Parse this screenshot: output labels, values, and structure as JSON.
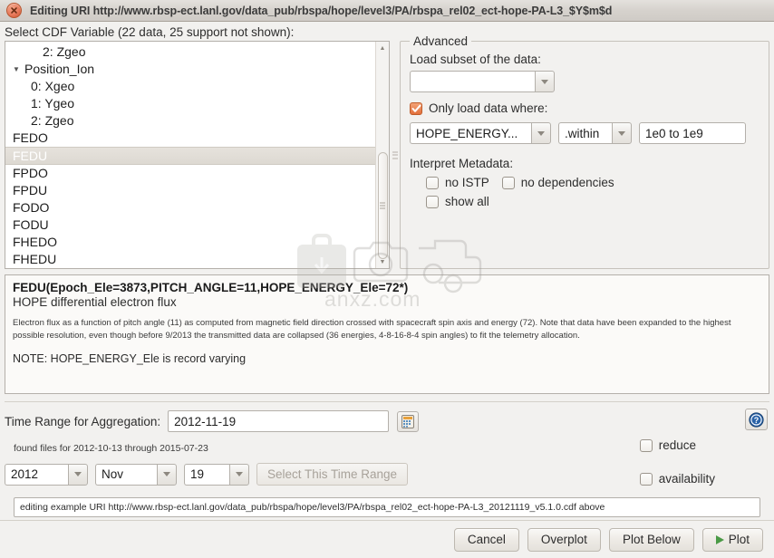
{
  "window": {
    "title": "Editing URI http://www.rbsp-ect.lanl.gov/data_pub/rbspa/hope/level3/PA/rbspa_rel02_ect-hope-PA-L3_$Y$m$d",
    "close_icon": "close-icon"
  },
  "variable_panel": {
    "label": "Select CDF Variable (22 data, 25 support not shown):",
    "rows": [
      {
        "text": "2: Zgeo",
        "indent": 1,
        "twisty": "",
        "selected": false
      },
      {
        "text": "Position_Ion",
        "indent": 0,
        "twisty": "▼",
        "selected": false
      },
      {
        "text": "0: Xgeo",
        "indent": 1,
        "twisty": "",
        "selected": false
      },
      {
        "text": "1: Ygeo",
        "indent": 1,
        "twisty": "",
        "selected": false
      },
      {
        "text": "2: Zgeo",
        "indent": 1,
        "twisty": "",
        "selected": false
      },
      {
        "text": "FEDO",
        "indent": 0,
        "twisty": "",
        "selected": false
      },
      {
        "text": "FEDU",
        "indent": 0,
        "twisty": "",
        "selected": true
      },
      {
        "text": "FPDO",
        "indent": 0,
        "twisty": "",
        "selected": false
      },
      {
        "text": "FPDU",
        "indent": 0,
        "twisty": "",
        "selected": false
      },
      {
        "text": "FODO",
        "indent": 0,
        "twisty": "",
        "selected": false
      },
      {
        "text": "FODU",
        "indent": 0,
        "twisty": "",
        "selected": false
      },
      {
        "text": "FHEDO",
        "indent": 0,
        "twisty": "",
        "selected": false
      },
      {
        "text": "FHEDU",
        "indent": 0,
        "twisty": "",
        "selected": false
      }
    ]
  },
  "advanced": {
    "legend": "Advanced",
    "load_subset_label": "Load subset of the data:",
    "load_subset_value": "",
    "only_load_checkbox": {
      "label": "Only load data where:",
      "checked": true
    },
    "filter": {
      "variable": "HOPE_ENERGY...",
      "operator": ".within",
      "value": "1e0 to 1e9"
    },
    "interpret_metadata_label": "Interpret Metadata:",
    "no_istp": {
      "label": "no ISTP",
      "checked": false
    },
    "no_dependencies": {
      "label": "no dependencies",
      "checked": false
    },
    "show_all": {
      "label": "show all",
      "checked": false
    }
  },
  "description": {
    "signature": "FEDU(Epoch_Ele=3873,PITCH_ANGLE=11,HOPE_ENERGY_Ele=72*)",
    "summary": "HOPE differential electron flux",
    "body": "Electron flux as a function of pitch angle (11) as computed from magnetic field direction crossed with spacecraft spin axis and energy (72). Note that data have been expanded to the highest possible resolution, even though before 9/2013 the transmitted data are collapsed (36 energies, 4-8-16-8-4 spin angles) to fit the telemetry allocation.",
    "note": "NOTE: HOPE_ENERGY_Ele is record varying"
  },
  "time_range": {
    "label": "Time Range for Aggregation:",
    "value": "2012-11-19",
    "calendar_icon": "calendar-icon",
    "help_icon": "help-icon",
    "found_files": "found files for 2012-10-13 through 2015-07-23",
    "year": "2012",
    "month": "Nov",
    "day": "19",
    "select_button": "Select This Time Range",
    "reduce": {
      "label": "reduce",
      "checked": false
    },
    "availability": {
      "label": "availability",
      "checked": false
    },
    "uri_status": "editing example URI http://www.rbsp-ect.lanl.gov/data_pub/rbspa/hope/level3/PA/rbspa_rel02_ect-hope-PA-L3_20121119_v5.1.0.cdf above"
  },
  "buttons": {
    "cancel": "Cancel",
    "overplot": "Overplot",
    "plot_below": "Plot Below",
    "plot": "Plot"
  },
  "watermark": {
    "text": "anxz.com"
  },
  "colors": {
    "accent_orange": "#e2703c",
    "help_blue": "#2a63a8",
    "play_green": "#4a9a46",
    "window_bg": "#f2f1ef"
  }
}
